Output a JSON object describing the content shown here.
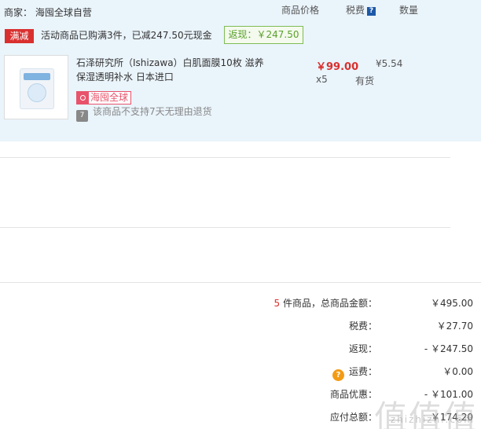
{
  "store": {
    "seller": "商家： 海囤全球自营",
    "headers": {
      "price": "商品价格",
      "tax": "税费",
      "tax_help": "?",
      "qty": "数量"
    },
    "promo": {
      "tag": "满减",
      "text": "活动商品已购满3件，已减247.50元现金",
      "rebate": "返现：￥247.50"
    },
    "item": {
      "title": "石泽研究所（Ishizawa）白肌面膜10枚 滋养保湿透明补水 日本进口",
      "badge": "海囤全球",
      "no_return_icon": "7",
      "no_return": "该商品不支持7天无理由退货",
      "price": "￥99.00",
      "tax": "¥5.54",
      "qty": "x5",
      "stock": "有货"
    }
  },
  "summary": {
    "count": "5",
    "count_suffix": " 件商品，总商品金额：",
    "total": "￥495.00",
    "tax_label": "税费：",
    "tax_value": "￥27.70",
    "rebate_label": "返现：",
    "rebate_value": "- ￥247.50",
    "shipping_icon": "?",
    "shipping_label": "运费：",
    "shipping_value": "￥0.00",
    "discount_label": "商品优惠：",
    "discount_value": "- ￥101.00",
    "payable_label": "应付总额：",
    "payable_value": "￥174.20"
  },
  "watermark": {
    "main": "值值值",
    "sub": "zhizhizhi.com"
  },
  "colors": {
    "accent_red": "#d9302f",
    "rebate_green": "#5aa02c",
    "store_bg": "#eaf4fb",
    "badge_pink": "#e8536b",
    "coin_orange": "#f39b15"
  }
}
